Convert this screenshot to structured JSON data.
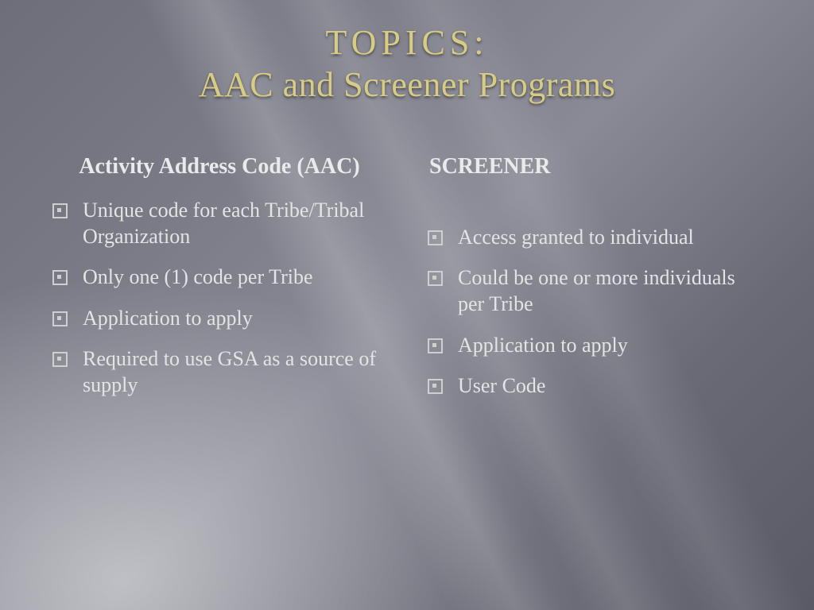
{
  "title": {
    "line1": "TOPICS:",
    "line2": "AAC and Screener Programs"
  },
  "left": {
    "heading": "Activity Address Code (AAC)",
    "items": [
      "Unique code for each Tribe/Tribal Organization",
      "Only one (1) code per Tribe",
      "Application to apply",
      "Required to use GSA as a source of supply"
    ]
  },
  "right": {
    "heading": "SCREENER",
    "items": [
      "Access granted to individual",
      "Could be one or more individuals per Tribe",
      "Application to apply",
      "User Code"
    ]
  }
}
